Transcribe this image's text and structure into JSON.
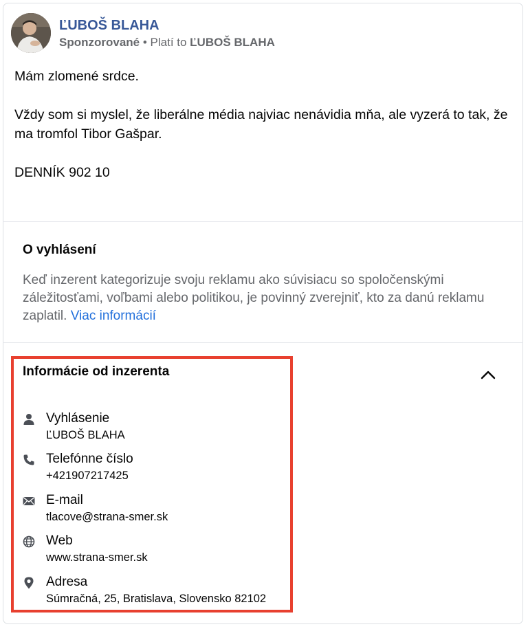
{
  "post": {
    "author": "ĽUBOŠ BLAHA",
    "sponsored_label": "Sponzorované",
    "separator": " • ",
    "paid_by_prefix": "Platí to ",
    "paid_by_name": "ĽUBOŠ BLAHA",
    "text_line1": "Mám zlomené srdce.",
    "text_line2": "Vždy som si myslel, že liberálne média najviac nenávidia mňa, ale vyzerá to tak, že ma tromfol Tibor Gašpar.",
    "text_line3": "DENNÍK 902 10"
  },
  "disclaimer": {
    "title": "O vyhlásení",
    "body": "Keď inzerent kategorizuje svoju reklamu ako súvisiacu so spoločenskými záležitosťami, voľbami alebo politikou, je povinný zverejniť, kto za danú reklamu zaplatil. ",
    "more_link": "Viac informácií"
  },
  "advertiser": {
    "title": "Informácie od inzerenta",
    "expanded": true,
    "items": [
      {
        "icon": "person-icon",
        "label": "Vyhlásenie",
        "value": "ĽUBOŠ BLAHA"
      },
      {
        "icon": "phone-icon",
        "label": "Telefónne číslo",
        "value": "+421907217425"
      },
      {
        "icon": "envelope-icon",
        "label": "E-mail",
        "value": "tlacove@strana-smer.sk"
      },
      {
        "icon": "globe-icon",
        "label": "Web",
        "value": "www.strana-smer.sk"
      },
      {
        "icon": "location-pin-icon",
        "label": "Adresa",
        "value": "Súmračná, 25, Bratislava, Slovensko 82102"
      }
    ]
  },
  "colors": {
    "author_link": "#385898",
    "more_link": "#216fdb",
    "highlight_box": "#e8402f",
    "secondary_text": "#65676b"
  }
}
